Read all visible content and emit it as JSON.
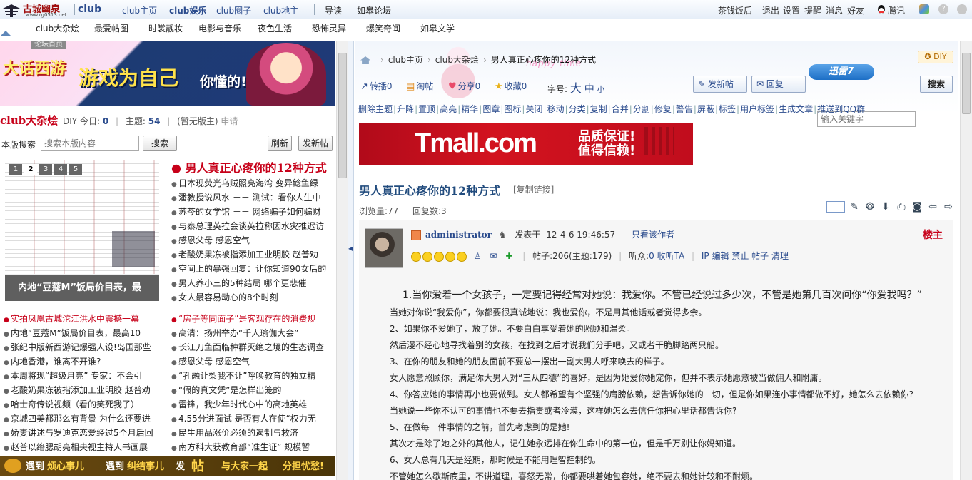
{
  "topbar": {
    "logo_name": "古城幽泉",
    "logo_url": "www.rg0513.net",
    "club_brand": "club",
    "nav": [
      "club主页",
      "club娱乐",
      "club圈子",
      "club地主"
    ],
    "nav_extra": [
      "导读",
      "如皋论坛"
    ],
    "right": [
      "茶钱饭后",
      "退出",
      "设置",
      "提醒",
      "消息",
      "好友",
      "腾讯"
    ]
  },
  "subnav": {
    "items": [
      "club大杂烩",
      "最爱帖图",
      "时裳靓妆",
      "电影与音乐",
      "夜色生活",
      "恐怖灵异",
      "爆笑奇闻",
      "如皋文学"
    ]
  },
  "left": {
    "banner": {
      "tag": "论坛首页",
      "logo": "大话西游",
      "title": "游戏为自己",
      "subtitle": "你懂的!"
    },
    "board": {
      "title": "club大杂烩",
      "diy": "DIY",
      "today_label": "今日:",
      "today": "0",
      "topics_label": "主题:",
      "topics": "54",
      "moderator": "(暂无版主)",
      "apply": "申请"
    },
    "search": {
      "label": "本版搜索",
      "placeholder": "搜索本版内容",
      "button": "搜索",
      "refresh": "刷新",
      "new_post": "发新帖"
    },
    "slideshow": {
      "pages": [
        "1",
        "2",
        "3",
        "4",
        "5"
      ],
      "active": "2",
      "caption": "内地“豆蔻M”饭局价目表，最"
    },
    "headline": "男人真正心疼你的12种方式",
    "list_a": [
      "日本现荧光乌贼照亮海湾 变异鲶鱼绿",
      "潘教授说风水 －－ 测试：看你人生中",
      "苏芩的女学馆 －－ 网络骗子如何骗财",
      "与泰总理英拉会谈英拉称因水灾推迟访",
      "感恩父母 感恩空气",
      "老酸奶果冻被指添加工业明胶 赵普劝",
      "空间上的暴强回复：让你知道90女后的",
      "男人养小三的5种结局 哪个更悲催",
      "女人最容易动心的8个时刻"
    ],
    "list_b": [
      {
        "text": "实拍凤凰古城沱江洪水中震撼一幕",
        "hot": true
      },
      {
        "text": "内地“豆蔻M”饭局价目表，最高10",
        "hot": false
      },
      {
        "text": "张纪中版新西游记爆强人设!岛国那些",
        "hot": false
      },
      {
        "text": "内地香港，谁离不开谁?",
        "hot": false
      },
      {
        "text": "本周将现“超级月亮” 专家：不会引",
        "hot": false
      },
      {
        "text": "老酸奶果冻被指添加工业明胶 赵普劝",
        "hot": false
      },
      {
        "text": "哈士奇传说视频（看的笑死我了）",
        "hot": false
      },
      {
        "text": "京城四美都那么有背景 为什么还要进",
        "hot": false
      },
      {
        "text": "娇妻讲述与罗迪克恋爱经过5个月后回",
        "hot": false
      },
      {
        "text": "赵普以络腮胡亮相央视主持人书画展",
        "hot": false
      }
    ],
    "list_c": [
      {
        "text": "“房子等同面子”是客观存在的消费规",
        "hot": true
      },
      {
        "text": "高清：扬州举办“千人瑜伽大会”",
        "hot": false
      },
      {
        "text": "长江刀鱼面临种群灭绝之境的生态调查",
        "hot": false
      },
      {
        "text": "感恩父母 感恩空气",
        "hot": false
      },
      {
        "text": "“孔融让梨我不让”呼唤教育的独立精",
        "hot": false
      },
      {
        "text": "“假的真文凭”是怎样出笼的",
        "hot": false
      },
      {
        "text": "雷锋，我少年时代心中的高地英雄",
        "hot": false
      },
      {
        "text": "4.55分进面试 是否有人在使“权力无",
        "hot": false
      },
      {
        "text": "民生用品涨价必须的遏制与救济",
        "hot": false
      },
      {
        "text": "南方科大获教育部“准生证” 规模暂",
        "hot": false
      }
    ],
    "bottom_banner": [
      "遇到",
      "烦心事儿",
      "遇到",
      "纠结事儿",
      "发",
      "帖",
      "与大家一起",
      "分担忧愁!"
    ]
  },
  "right": {
    "breadcrumb": [
      "club主页",
      "club大杂烩",
      "男人真正心疼你的12种方式"
    ],
    "diy_label": "DIY",
    "deco_text": "happy time",
    "toolbar": {
      "items": [
        {
          "icon": "share-icon",
          "label": "转播0"
        },
        {
          "icon": "taobao-icon",
          "label": "淘帖"
        },
        {
          "icon": "heart-icon",
          "label": "分享0"
        },
        {
          "icon": "star-icon",
          "label": "收藏0"
        }
      ],
      "font_label": "字号:",
      "font_big": "大",
      "font_mid": "中",
      "font_small": "小",
      "new_post": "发新帖",
      "reply": "回复",
      "xunlei": "迅雷7",
      "search_placeholder": "输入关键字",
      "search_button": "搜索"
    },
    "admin_actions": [
      "删除主题",
      "升降",
      "置顶",
      "高亮",
      "精华",
      "图章",
      "图标",
      "关闭",
      "移动",
      "分类",
      "复制",
      "合并",
      "分割",
      "修复",
      "警告",
      "屏蔽",
      "标签",
      "用户标签",
      "生成文章",
      "推送到QQ群"
    ],
    "ad": {
      "brand": "Tmall.com",
      "line1": "品质保证!",
      "line2": "值得信赖!"
    },
    "post_title": "男人真正心疼你的12种方式",
    "copy_link": "[复制链接]",
    "views_label": "浏览量:",
    "views": "77",
    "replies_label": "回复数:",
    "replies": "3",
    "post": {
      "author": "administrator",
      "posted_label": "发表于",
      "posted_time": "12-4-6 19:46:57",
      "only_author": "只看该作者",
      "floor": "楼主",
      "posts_label": "帖子:",
      "posts": "206",
      "topics_text": "(主题:179)",
      "fans_label": "听众:",
      "fans": "0",
      "listen": "收听TA",
      "links": [
        "IP",
        "编辑",
        "禁止",
        "帖子",
        "清理"
      ]
    },
    "content": [
      "1.当你爱着一个女孩子，一定要记得经常对她说：我爱你。不管已经说过多少次，不管是她第几百次问你“你爱我吗？”",
      "当她对你说“我爱你”，你都要很真诚地说：我也爱你，不是用其他话或者觉得多余。",
      "2、如果你不爱她了，放了她。不要白白享受着她的照顾和温柔。",
      "然后漫不经心地寻找着别的女孩，在找到之后才说我们分手吧，又或者干脆脚踏两只船。",
      "3、在你的朋友和她的朋友面前不要总一摆出一副大男人呼来唤去的样子。",
      "女人愿意照顾你，满足你大男人对“三从四德”的喜好，是因为她爱你她宠你，但并不表示她愿意被当做佣人和附庸。",
      "4、你答应她的事情再小也要做到。女人都希望有个坚强的肩膀依赖，想告诉你她的一切，但是你如果连小事情都做不好，她怎么去依赖你?",
      "当她说一些你不认可的事情也不要去指责或者冷漠，这样她怎么去信任你把心里话都告诉你?",
      "5、在做每一件事情的之前，首先考虑到的是她!",
      "其次才是除了她之外的其他人，记住她永远排在你生命中的第一位，但是千万别让你妈知道。",
      "6、女人总有几天是经期，那时候是不能用理智控制的。",
      "不管她怎么歇斯底里，不讲道理，喜怒无常，你都要哄着她包容她，绝不要去和她计较和不耐烦。"
    ]
  }
}
